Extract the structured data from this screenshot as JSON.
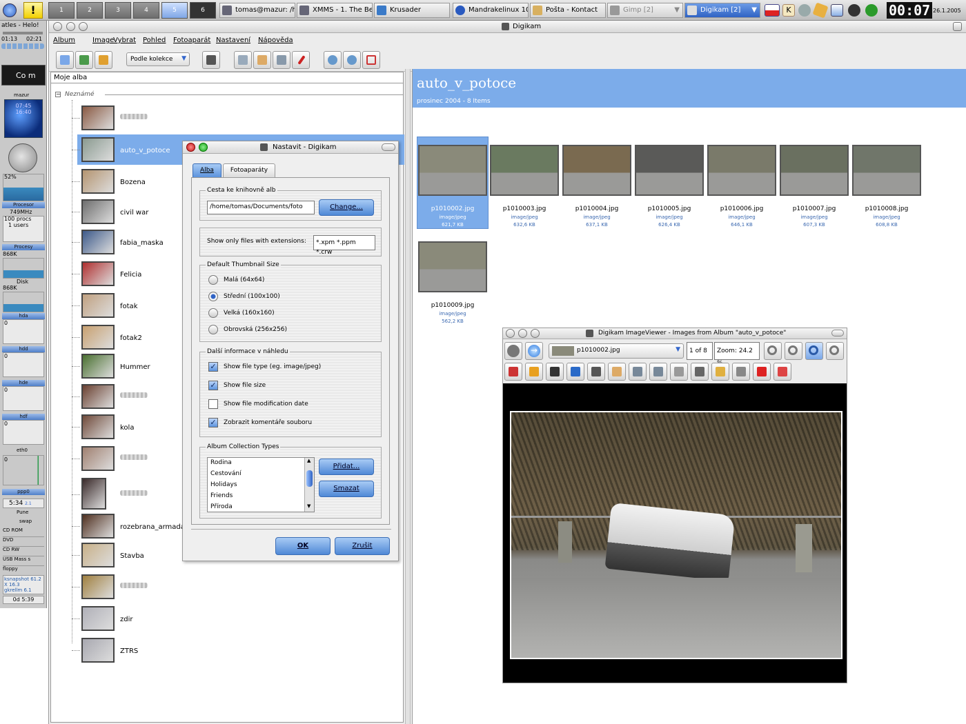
{
  "taskbar": {
    "desktops": [
      "1",
      "2",
      "3",
      "4",
      "5",
      "6"
    ],
    "tasks": [
      {
        "label": "tomas@mazur: /h",
        "icon": "terminal-icon"
      },
      {
        "label": "XMMS - 1. The Be",
        "icon": "xmms-icon"
      },
      {
        "label": "Krusader",
        "icon": "krusader-icon"
      },
      {
        "label": "Mandrakelinux 10",
        "icon": "browser-icon"
      },
      {
        "label": "Pošta - Kontact",
        "icon": "mail-icon"
      },
      {
        "label": "Gimp [2]",
        "icon": "gimp-icon"
      },
      {
        "label": "Digikam [2]",
        "icon": "digikam-icon"
      }
    ],
    "clock": "00:07",
    "date": "26.1.2005"
  },
  "gkrellm": {
    "top_text": "atles - Helo!",
    "times": [
      "01:13",
      "02:21"
    ],
    "title": "Co m",
    "host": "mazur",
    "sun_time1": "07:45",
    "sun_time2": "16:40",
    "cpu_pct": "52%",
    "cpu_label": "Procesor",
    "cpu_freq": "749MHz",
    "procs": "100 procs",
    "users": "1 users",
    "proc_label": "Procesy",
    "mem1": "868K",
    "disk_label": "Disk",
    "mem2": "868K",
    "drives": [
      {
        "label": "hda",
        "value": "0"
      },
      {
        "label": "hdd",
        "value": "0"
      },
      {
        "label": "hde",
        "value": "0"
      },
      {
        "label": "hdf",
        "value": "0"
      }
    ],
    "net_label": "eth0",
    "net_value": "0",
    "ppp_label": "ppp0",
    "ppp_time": "5:34",
    "ppp_small": "2.1",
    "pune": "Pune",
    "swap": "swap",
    "mounts": [
      "CD ROM",
      "DVD",
      "CD RW",
      "USB Mass s",
      "floppy"
    ],
    "procs_list": [
      "ksnapshot 61.2",
      "X 16.3",
      "gkrellm 6.1"
    ],
    "uptime": "0d 5:39"
  },
  "window": {
    "title": "Digikam",
    "menu": [
      "Album",
      "Image",
      "Vybrat",
      "Pohled",
      "Fotoaparát",
      "Nastavení",
      "Nápověda"
    ],
    "sort_select": "Podle kolekce"
  },
  "albums": {
    "header": "Moje alba",
    "group": "Neznámé",
    "items": [
      {
        "label": "",
        "blur": true,
        "color": "#8a5a44"
      },
      {
        "label": "auto_v_potoce",
        "selected": true,
        "color": "#8a9a90"
      },
      {
        "label": "Bozena",
        "color": "#b49470"
      },
      {
        "label": "civil war",
        "color": "#6e6e6e"
      },
      {
        "label": "fabia_maska",
        "color": "#3d5a8a"
      },
      {
        "label": "Felicia",
        "color": "#b03030"
      },
      {
        "label": "fotak",
        "color": "#c0a080"
      },
      {
        "label": "fotak2",
        "color": "#c8a070"
      },
      {
        "label": "Hummer",
        "color": "#4a7030"
      },
      {
        "label": "",
        "blur": true,
        "color": "#6a4030"
      },
      {
        "label": "kola",
        "color": "#704a3a"
      },
      {
        "label": "",
        "blur": true,
        "color": "#a08070"
      },
      {
        "label": "",
        "blur": true,
        "color": "#3a2a2a"
      },
      {
        "label": "rozebrana_armada",
        "color": "#503020"
      },
      {
        "label": "Stavba",
        "color": "#c8b088"
      },
      {
        "label": "",
        "blur": true,
        "color": "#a08040"
      },
      {
        "label": "zdir",
        "color": "#b0b0b8"
      },
      {
        "label": "ZTRS",
        "color": "#a8a8b0"
      }
    ]
  },
  "iconview": {
    "title": "auto_v_potoce",
    "subtitle": "prosinec 2004 - 8 Items",
    "images": [
      {
        "name": "p1010002.jpg",
        "type": "image/jpeg",
        "size": "621,7 KB",
        "selected": true
      },
      {
        "name": "p1010003.jpg",
        "type": "image/jpeg",
        "size": "632,6 KB"
      },
      {
        "name": "p1010004.jpg",
        "type": "image/jpeg",
        "size": "637,1 KB"
      },
      {
        "name": "p1010005.jpg",
        "type": "image/jpeg",
        "size": "626,4 KB"
      },
      {
        "name": "p1010006.jpg",
        "type": "image/jpeg",
        "size": "646,1 KB"
      },
      {
        "name": "p1010007.jpg",
        "type": "image/jpeg",
        "size": "607,3 KB"
      },
      {
        "name": "p1010008.jpg",
        "type": "image/jpeg",
        "size": "608,8 KB"
      },
      {
        "name": "p1010009.jpg",
        "type": "image/jpeg",
        "size": "562,2 KB"
      }
    ]
  },
  "dialog": {
    "title": "Nastavit - Digikam",
    "tabs": [
      "Alba",
      "Fotoaparáty"
    ],
    "path_group": "Cesta ke knihovně alb",
    "path_value": "/home/tomas/Documents/foto",
    "change_btn": "Change...",
    "ext_label": "Show only files with extensions:",
    "ext_value": "*.xpm *.ppm *.crw",
    "thumb_group": "Default Thumbnail Size",
    "thumb_sizes": [
      {
        "label": "Malá (64x64)",
        "checked": false
      },
      {
        "label": "Střední (100x100)",
        "checked": true
      },
      {
        "label": "Velká (160x160)",
        "checked": false
      },
      {
        "label": "Obrovská (256x256)",
        "checked": false
      }
    ],
    "info_group": "Další informace v náhledu",
    "info_options": [
      {
        "label": "Show file type (eg. image/jpeg)",
        "checked": true
      },
      {
        "label": "Show file size",
        "checked": true
      },
      {
        "label": "Show file modification date",
        "checked": false
      },
      {
        "label": "Zobrazit komentáře souboru",
        "checked": true
      }
    ],
    "coll_group": "Album Collection Types",
    "collections": [
      "Rodina",
      "Cestování",
      "Holidays",
      "Friends",
      "Příroda"
    ],
    "add_btn": "Přidat...",
    "del_btn": "Smazat",
    "ok_btn": "OK",
    "cancel_btn": "Zrušit"
  },
  "viewer": {
    "title": "Digikam ImageViewer - Images from Album \"auto_v_potoce\"",
    "file": "p1010002.jpg",
    "count": "1 of 8",
    "zoom": "Zoom: 24.2 %"
  }
}
